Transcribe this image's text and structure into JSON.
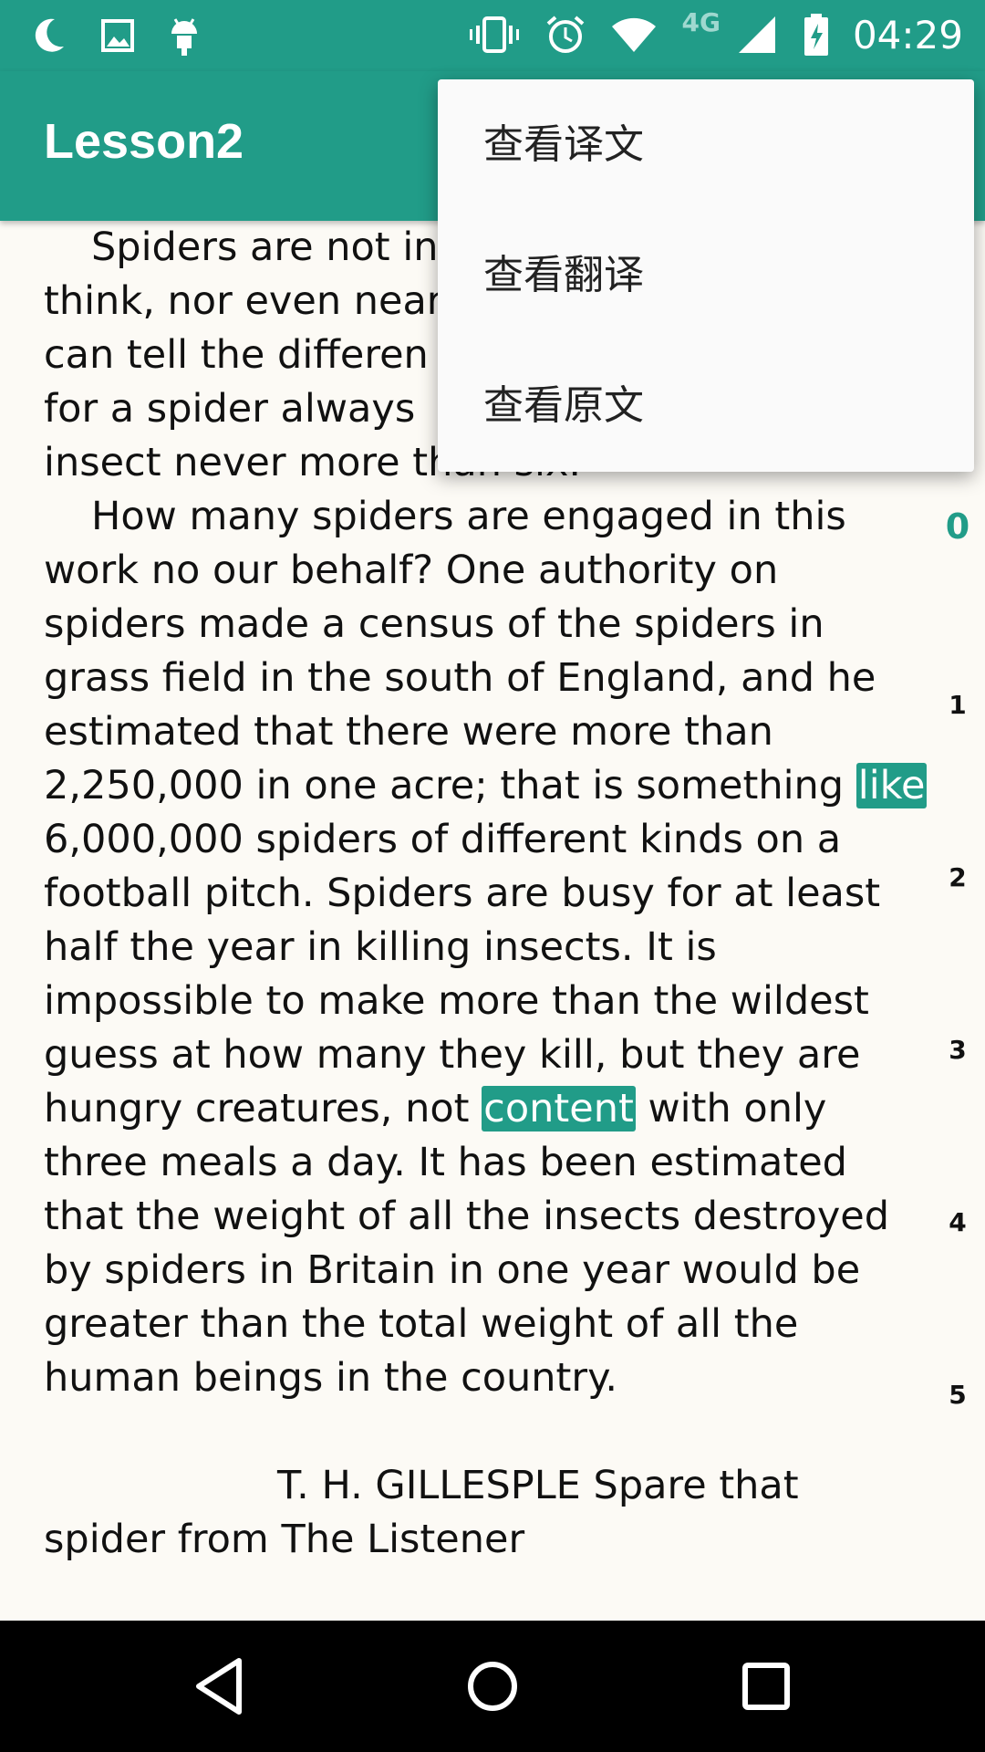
{
  "status_bar": {
    "time": "04:29",
    "network_label": "4G",
    "icons_left": [
      "moon-icon",
      "image-icon",
      "android-icon"
    ],
    "icons_right": [
      "vibrate-icon",
      "alarm-icon",
      "wifi-icon",
      "signal-icon",
      "battery-charging-icon"
    ]
  },
  "app_bar": {
    "title": "Lesson2",
    "color": "#219c88"
  },
  "menu": {
    "items": [
      {
        "label": "查看译文"
      },
      {
        "label": "查看翻译"
      },
      {
        "label": "查看原文"
      }
    ]
  },
  "content": {
    "p1": {
      "lines": [
        "Spiders are not in",
        "think, nor even near",
        "can tell the differen",
        "for a spider always",
        "insect never more than six."
      ]
    },
    "p2": {
      "part1": "How many spiders are engaged in this work no our behalf? One authority on spiders made a census of the spiders in grass field in the south of England, and he estimated that there were more than 2,250,000 in one acre; that is something",
      "highlight1": "like",
      "part2": "6,000,000 spiders of different kinds on a football pitch. Spiders are busy for at least half the year in killing insects. It is impossible to make more than the wildest guess at how many they kill, but they are hungry creatures, not",
      "highlight2": "content",
      "part3": "with only three meals a day. It has been estimated that the weight of all the insects destroyed by spiders in Britain in one year would be greater than the total weight of all the human beings in the country."
    },
    "signature": "T. H. GILLESPLE Spare that spider from The Listener"
  },
  "gutter": {
    "numbers": [
      "0",
      "1",
      "2",
      "3",
      "4",
      "5"
    ],
    "active": "0"
  },
  "nav_bar": {
    "buttons": [
      "back-icon",
      "home-icon",
      "recents-icon"
    ]
  }
}
